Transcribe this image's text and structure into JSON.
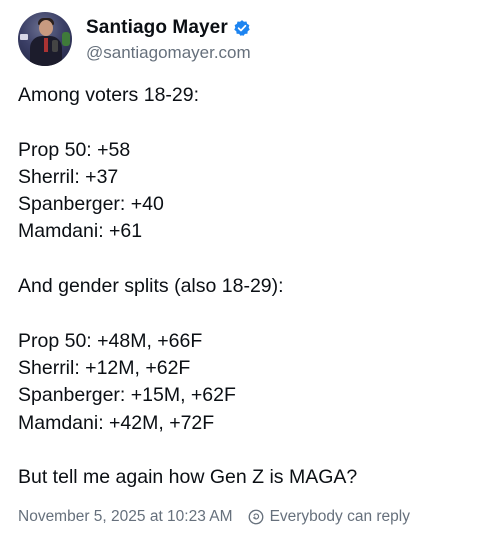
{
  "author": {
    "display_name": "Santiago Mayer",
    "handle": "@santiagomayer.com",
    "verified": true,
    "verified_color": "#1d84f0",
    "avatar_icon": "profile-photo"
  },
  "post": {
    "lines": [
      "Among voters 18-29:",
      "",
      "Prop 50: +58",
      "Sherril: +37",
      "Spanberger: +40",
      "Mamdani: +61",
      "",
      "And gender splits (also 18-29):",
      "",
      "Prop 50: +48M, +66F",
      "Sherril: +12M, +62F",
      "Spanberger: +15M, +62F",
      "Mamdani: +42M, +72F",
      "",
      "But tell me again how Gen Z is MAGA?"
    ]
  },
  "footer": {
    "timestamp": "November 5, 2025 at 10:23 AM",
    "reply_setting": "Everybody can reply",
    "reply_icon": "reply-settings-icon"
  },
  "colors": {
    "text": "#0b0f14",
    "muted": "#66707c"
  }
}
